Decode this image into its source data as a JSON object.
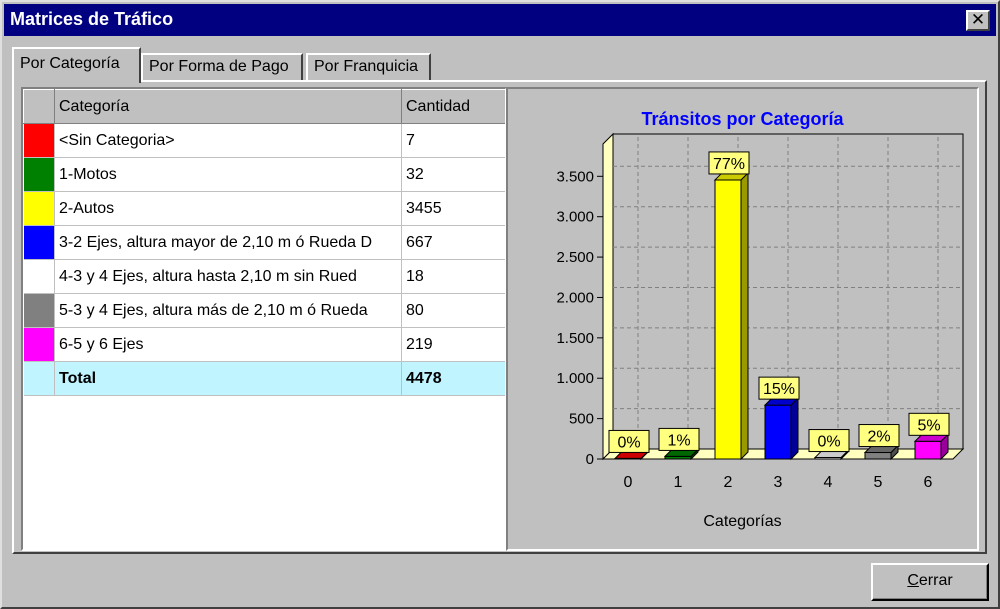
{
  "window": {
    "title": "Matrices de Tráfico",
    "close_glyph": "✕"
  },
  "tabs": [
    {
      "label": "Por Categoría",
      "active": true
    },
    {
      "label": "Por Forma de Pago",
      "active": false
    },
    {
      "label": "Por Franquicia",
      "active": false
    }
  ],
  "table": {
    "headers": [
      "Categoría",
      "Cantidad"
    ],
    "rows": [
      {
        "color": "#ff0000",
        "category": "<Sin Categoria>",
        "count": "7"
      },
      {
        "color": "#008000",
        "category": "1-Motos",
        "count": "32"
      },
      {
        "color": "#ffff00",
        "category": "2-Autos",
        "count": "3455"
      },
      {
        "color": "#0000ff",
        "category": "3-2 Ejes, altura mayor de 2,10 m ó Rueda D",
        "count": "667"
      },
      {
        "color": "#ffffff",
        "category": "4-3 y 4 Ejes, altura hasta 2,10 m sin Rued",
        "count": "18"
      },
      {
        "color": "#808080",
        "category": "5-3 y 4 Ejes, altura más de 2,10 m ó Rueda",
        "count": "80"
      },
      {
        "color": "#ff00ff",
        "category": "6-5 y 6 Ejes",
        "count": "219"
      }
    ],
    "total": {
      "color": "#c0f4ff",
      "label": "Total",
      "count": "4478"
    }
  },
  "chart_data": {
    "type": "bar",
    "title": "Tránsitos por Categoría",
    "xlabel": "Categorías",
    "ylabel": "",
    "categories": [
      "0",
      "1",
      "2",
      "3",
      "4",
      "5",
      "6"
    ],
    "values": [
      7,
      32,
      3455,
      667,
      18,
      80,
      219
    ],
    "data_labels": [
      "0%",
      "1%",
      "77%",
      "15%",
      "0%",
      "2%",
      "5%"
    ],
    "bar_colors": [
      "#ff0000",
      "#008000",
      "#ffff00",
      "#0000ff",
      "#ffffff",
      "#808080",
      "#ff00ff"
    ],
    "y_ticks": [
      0,
      500,
      1000,
      1500,
      2000,
      2500,
      3000,
      3500
    ],
    "y_tick_labels": [
      "0",
      "500",
      "1.000",
      "1.500",
      "2.000",
      "2.500",
      "3.000",
      "3.500"
    ],
    "ylim": [
      0,
      3900
    ],
    "grid": true,
    "style": "3d"
  },
  "footer": {
    "close_button": "Cerrar",
    "close_accel": "C",
    "close_rest": "errar"
  }
}
